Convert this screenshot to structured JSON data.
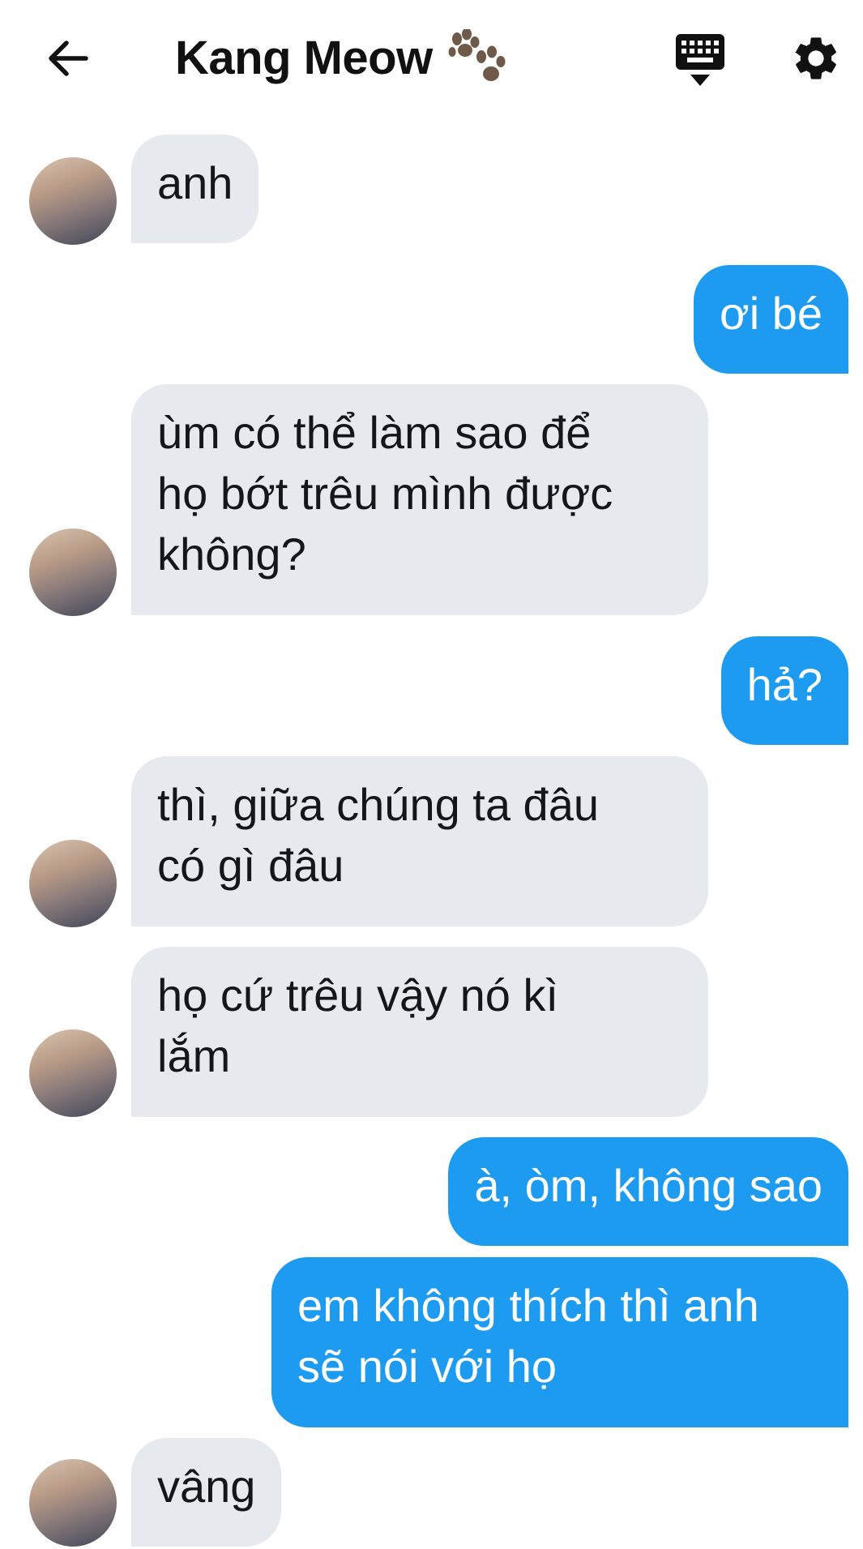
{
  "header": {
    "title": "Kang Meow",
    "icons": [
      "back-arrow-icon",
      "paw-icon",
      "keyboard-icon",
      "gear-icon"
    ]
  },
  "colors": {
    "outgoing_bubble": "#1d9bf0",
    "incoming_bubble": "#e6eaee"
  },
  "messages": [
    {
      "side": "in",
      "text": "anh"
    },
    {
      "side": "out",
      "text": "ơi bé"
    },
    {
      "side": "in",
      "text": "ùm có thể làm sao để\nhọ bớt trêu mình được\nkhông?"
    },
    {
      "side": "out",
      "text": "hả?"
    },
    {
      "side": "in",
      "text": "thì, giữa chúng ta đâu\ncó gì đâu"
    },
    {
      "side": "in",
      "text": "họ cứ trêu vậy nó kì\nlắm"
    },
    {
      "side": "out",
      "text": "à, òm, không sao"
    },
    {
      "side": "out",
      "text": "em không thích thì anh\nsẽ nói với họ"
    },
    {
      "side": "in",
      "text": "vâng"
    }
  ]
}
